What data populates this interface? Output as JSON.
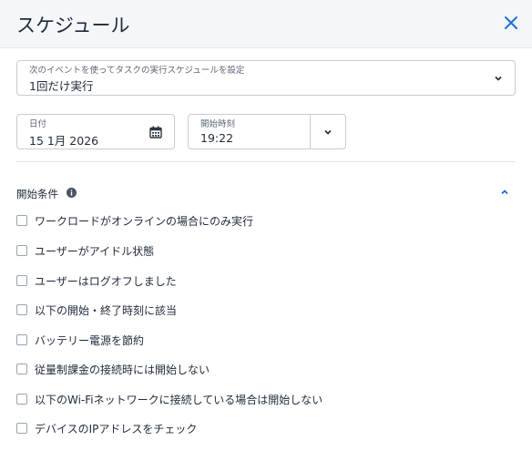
{
  "dialog": {
    "title": "スケジュール"
  },
  "trigger": {
    "label": "次のイベントを使ってタスクの実行スケジュールを設定",
    "value": "1回だけ実行"
  },
  "date": {
    "label": "日付",
    "value": "15 1月 2026"
  },
  "time": {
    "label": "開始時刻",
    "value": "19:22"
  },
  "conditions": {
    "title": "開始条件",
    "items": [
      "ワークロードがオンラインの場合にのみ実行",
      "ユーザーがアイドル状態",
      "ユーザーはログオフしました",
      "以下の開始・終了時刻に該当",
      "バッテリー電源を節約",
      "従量制課金の接続時には開始しない",
      "以下のWi-Fiネットワークに接続している場合は開始しない",
      "デバイスのIPアドレスをチェック"
    ]
  },
  "colors": {
    "accent": "#1f6fd6",
    "text": "#1f2a3a",
    "border": "#c7ccd4"
  }
}
